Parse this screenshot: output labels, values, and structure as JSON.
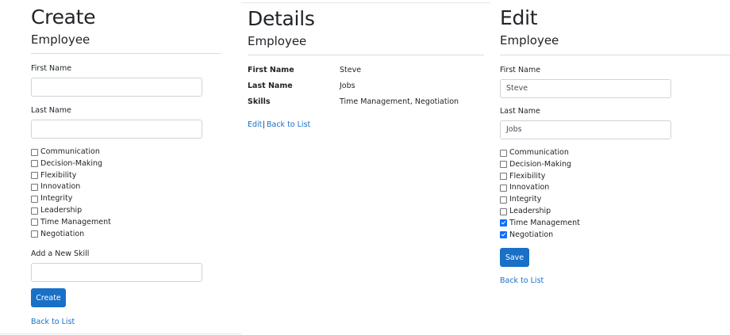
{
  "create": {
    "title": "Create",
    "subtitle": "Employee",
    "first_name_label": "First Name",
    "first_name_value": "",
    "last_name_label": "Last Name",
    "last_name_value": "",
    "skills": [
      {
        "label": "Communication",
        "checked": false
      },
      {
        "label": "Decision-Making",
        "checked": false
      },
      {
        "label": "Flexibility",
        "checked": false
      },
      {
        "label": "Innovation",
        "checked": false
      },
      {
        "label": "Integrity",
        "checked": false
      },
      {
        "label": "Leadership",
        "checked": false
      },
      {
        "label": "Time Management",
        "checked": false
      },
      {
        "label": "Negotiation",
        "checked": false
      }
    ],
    "new_skill_label": "Add a New Skill",
    "new_skill_value": "",
    "create_button": "Create",
    "back_link": "Back to List"
  },
  "details": {
    "title": "Details",
    "subtitle": "Employee",
    "fields": [
      {
        "term": "First Name",
        "value": "Steve"
      },
      {
        "term": "Last Name",
        "value": "Jobs"
      },
      {
        "term": "Skills",
        "value": "Time Management, Negotiation"
      }
    ],
    "edit_link": "Edit",
    "separator": "|",
    "back_link": "Back to List"
  },
  "edit": {
    "title": "Edit",
    "subtitle": "Employee",
    "first_name_label": "First Name",
    "first_name_value": "Steve",
    "last_name_label": "Last Name",
    "last_name_value": "Jobs",
    "skills": [
      {
        "label": "Communication",
        "checked": false
      },
      {
        "label": "Decision-Making",
        "checked": false
      },
      {
        "label": "Flexibility",
        "checked": false
      },
      {
        "label": "Innovation",
        "checked": false
      },
      {
        "label": "Integrity",
        "checked": false
      },
      {
        "label": "Leadership",
        "checked": false
      },
      {
        "label": "Time Management",
        "checked": true
      },
      {
        "label": "Negotiation",
        "checked": true
      }
    ],
    "save_button": "Save",
    "back_link": "Back to List"
  },
  "colors": {
    "link": "#1a6fc7",
    "button": "#1a6fc7",
    "checkbox_checked": "#0d6efd"
  }
}
